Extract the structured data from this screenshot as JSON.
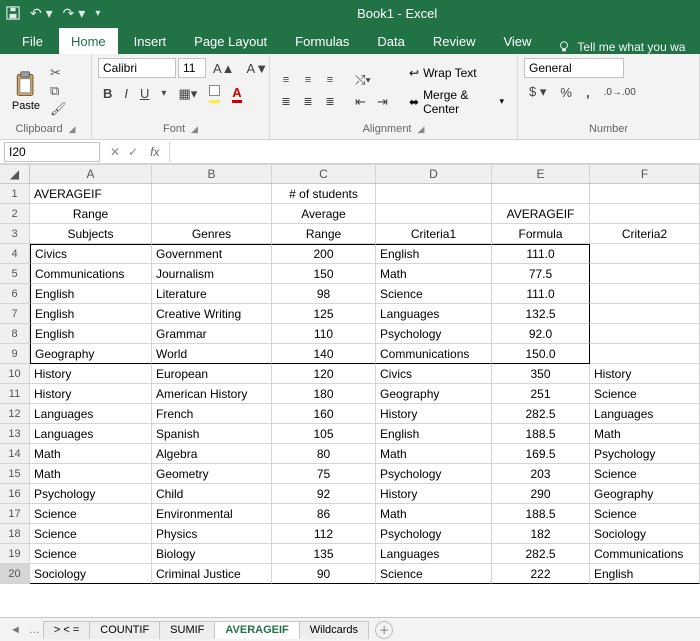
{
  "app": {
    "title": "Book1 - Excel"
  },
  "ribbon_tabs": [
    "File",
    "Home",
    "Insert",
    "Page Layout",
    "Formulas",
    "Data",
    "Review",
    "View"
  ],
  "active_ribbon_tab": "Home",
  "tell_me": "Tell me what you wa",
  "clipboard": {
    "paste": "Paste",
    "group": "Clipboard"
  },
  "font": {
    "name": "Calibri",
    "size": "11",
    "group": "Font",
    "bold": "B",
    "italic": "I",
    "underline": "U"
  },
  "alignment": {
    "group": "Alignment",
    "wrap": "Wrap Text",
    "merge": "Merge & Center"
  },
  "number": {
    "group": "Number",
    "format": "General",
    "dollar": "$",
    "percent": "%",
    "comma": ",",
    "dec_inc": ".0",
    "dec_dec": ".00"
  },
  "namebox": "I20",
  "formula_bar": "",
  "columns": [
    "A",
    "B",
    "C",
    "D",
    "E",
    "F"
  ],
  "chart_data": {
    "type": "table",
    "title": "AVERAGEIF",
    "header_rows": [
      [
        "AVERAGEIF",
        "",
        "# of students",
        "",
        "",
        ""
      ],
      [
        "Range",
        "",
        "Average",
        "",
        "AVERAGEIF",
        ""
      ],
      [
        "Subjects",
        "Genres",
        "Range",
        "Criteria1",
        "Formula",
        "Criteria2"
      ]
    ],
    "rows": [
      [
        "Civics",
        "Government",
        "200",
        "English",
        "111.0",
        ""
      ],
      [
        "Communications",
        "Journalism",
        "150",
        "Math",
        "77.5",
        ""
      ],
      [
        "English",
        "Literature",
        "98",
        "Science",
        "111.0",
        ""
      ],
      [
        "English",
        "Creative Writing",
        "125",
        "Languages",
        "132.5",
        ""
      ],
      [
        "English",
        "Grammar",
        "110",
        "Psychology",
        "92.0",
        ""
      ],
      [
        "Geography",
        "World",
        "140",
        "Communications",
        "150.0",
        ""
      ],
      [
        "History",
        "European",
        "120",
        "Civics",
        "350",
        "History"
      ],
      [
        "History",
        "American History",
        "180",
        "Geography",
        "251",
        "Science"
      ],
      [
        "Languages",
        "French",
        "160",
        "History",
        "282.5",
        "Languages"
      ],
      [
        "Languages",
        "Spanish",
        "105",
        "English",
        "188.5",
        "Math"
      ],
      [
        "Math",
        "Algebra",
        "80",
        "Math",
        "169.5",
        "Psychology"
      ],
      [
        "Math",
        "Geometry",
        "75",
        "Psychology",
        "203",
        "Science"
      ],
      [
        "Psychology",
        "Child",
        "92",
        "History",
        "290",
        "Geography"
      ],
      [
        "Science",
        "Environmental",
        "86",
        "Math",
        "188.5",
        "Science"
      ],
      [
        "Science",
        "Physics",
        "112",
        "Psychology",
        "182",
        "Sociology"
      ],
      [
        "Science",
        "Biology",
        "135",
        "Languages",
        "282.5",
        "Communications"
      ],
      [
        "Sociology",
        "Criminal Justice",
        "90",
        "Science",
        "222",
        "English"
      ]
    ]
  },
  "sheet_tabs": [
    "> < =",
    "COUNTIF",
    "SUMIF",
    "AVERAGEIF",
    "Wildcards"
  ],
  "active_sheet_tab": "AVERAGEIF",
  "row_start": 1
}
